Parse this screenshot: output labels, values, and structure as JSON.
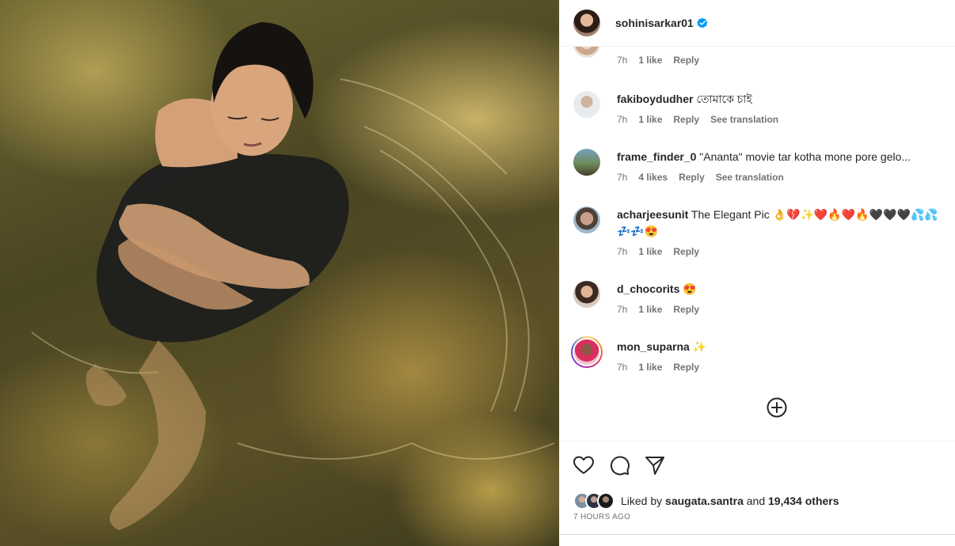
{
  "post": {
    "author": "sohinisarkar01",
    "verified": true,
    "photo_icon": "post-photo"
  },
  "comments": [
    {
      "username": "",
      "text": "",
      "time": "7h",
      "likes": "1 like",
      "reply": "Reply",
      "translation": ""
    },
    {
      "username": "fakiboydudher",
      "text": "তোমাকে চাই",
      "time": "7h",
      "likes": "1 like",
      "reply": "Reply",
      "translation": "See translation"
    },
    {
      "username": "frame_finder_0",
      "text": "\"Ananta\" movie tar kotha mone pore gelo...",
      "time": "7h",
      "likes": "4 likes",
      "reply": "Reply",
      "translation": "See translation"
    },
    {
      "username": "acharjeesunit",
      "text": "The Elegant Pic 👌💔✨❤️🔥❤️🔥🖤🖤🖤💦💦💤💤😍",
      "time": "7h",
      "likes": "1 like",
      "reply": "Reply",
      "translation": ""
    },
    {
      "username": "d_chocorits",
      "text": "😍",
      "time": "7h",
      "likes": "1 like",
      "reply": "Reply",
      "translation": ""
    },
    {
      "username": "mon_suparna",
      "text": "✨",
      "time": "7h",
      "likes": "1 like",
      "reply": "Reply",
      "translation": ""
    }
  ],
  "actions": {
    "like_icon": "heart-icon",
    "comment_icon": "comment-icon",
    "share_icon": "share-icon",
    "more_icon": "plus-circle-icon"
  },
  "likes": {
    "prefix": "Liked by",
    "user": "saugata.santra",
    "joiner": "and",
    "others": "19,434 others"
  },
  "timestamp": "7 HOURS AGO",
  "colors": {
    "verified_blue": "#0095f6",
    "story_ring": "#d62976",
    "meta_gray": "#737373"
  }
}
